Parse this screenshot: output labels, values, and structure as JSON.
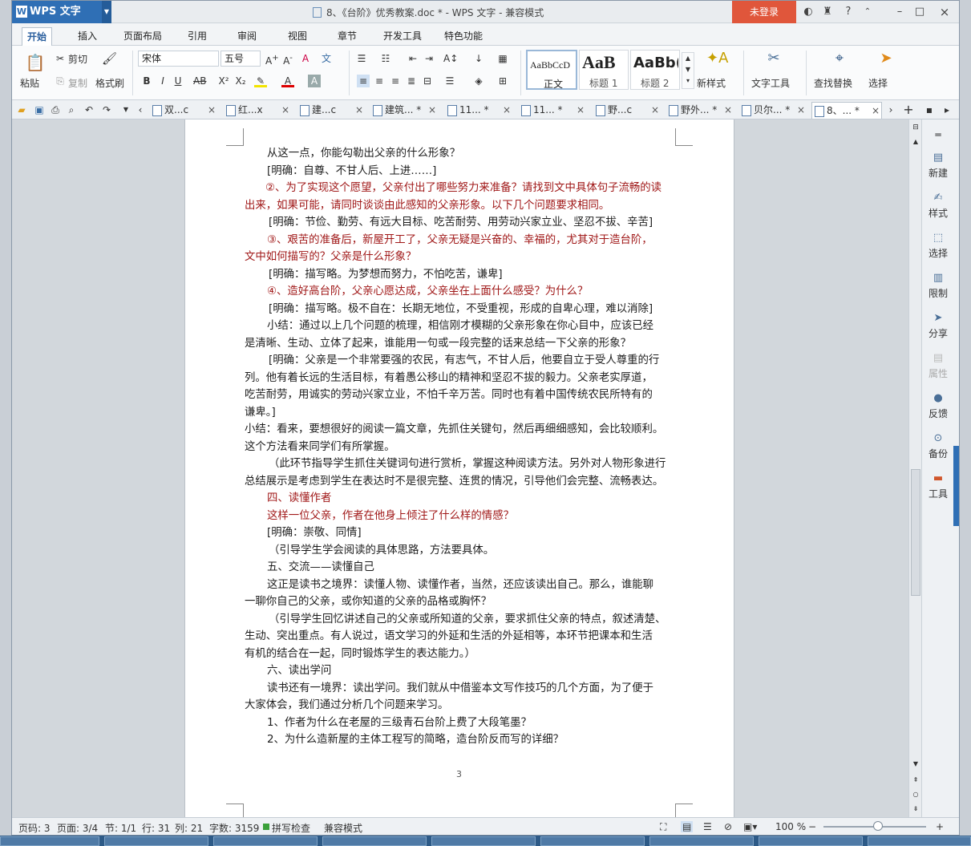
{
  "titlebar": {
    "app_name": "WPS 文字",
    "doc_title": "8、《台阶》优秀教案.doc * - WPS 文字 - 兼容模式",
    "login": "未登录"
  },
  "menu": [
    "开始",
    "插入",
    "页面布局",
    "引用",
    "审阅",
    "视图",
    "章节",
    "开发工具",
    "特色功能"
  ],
  "ribbon": {
    "paste": "粘贴",
    "cut": "剪切",
    "copy": "复制",
    "format_painter": "格式刷",
    "font_name": "宋体",
    "font_size": "五号",
    "styles": [
      {
        "preview": "AaBbCcD",
        "name": "正文"
      },
      {
        "preview": "AaB",
        "name": "标题 1"
      },
      {
        "preview": "AaBb(",
        "name": "标题 2"
      }
    ],
    "new_style": "新样式",
    "text_tools": "文字工具",
    "find_replace": "查找替换",
    "select": "选择"
  },
  "tabs": [
    {
      "label": "双...c",
      "active": false
    },
    {
      "label": "红...x",
      "active": false
    },
    {
      "label": "建...c",
      "active": false
    },
    {
      "label": "建筑... *",
      "active": false
    },
    {
      "label": "11... *",
      "active": false
    },
    {
      "label": "11... *",
      "active": false
    },
    {
      "label": "野...c",
      "active": false
    },
    {
      "label": "野外... *",
      "active": false
    },
    {
      "label": "贝尔... *",
      "active": false
    },
    {
      "label": "8、... *",
      "active": true
    }
  ],
  "document": {
    "lines": [
      {
        "text": "从这一点，你能勾勒出父亲的什么形象？",
        "red": false
      },
      {
        "text": "[明确：自尊、不甘人后、上进……]",
        "red": false
      },
      {
        "text": "②、为了实现这个愿望，父亲付出了哪些努力来准备？请找到文中具体句子流畅的读",
        "red": true
      },
      {
        "text": "出来，如果可能，请同时谈谈由此感知的父亲形象。以下几个问题要求相同。",
        "red": true
      },
      {
        "text": "[明确：节俭、勤劳、有远大目标、吃苦耐劳、用劳动兴家立业、坚忍不拔、辛苦]",
        "red": false
      },
      {
        "text": "③、艰苦的准备后，新屋开工了，父亲无疑是兴奋的、幸福的，尤其对于造台阶，",
        "red": true
      },
      {
        "text": "文中如何描写的？父亲是什么形象？",
        "red": true
      },
      {
        "text": "[明确：描写略。为梦想而努力，不怕吃苦，谦卑]",
        "red": false
      },
      {
        "text": "④、造好高台阶，父亲心愿达成，父亲坐在上面什么感受？为什么？",
        "red": true
      },
      {
        "text": "[明确：描写略。极不自在：长期无地位，不受重视，形成的自卑心理，难以消除]",
        "red": false
      },
      {
        "text": "小结：通过以上几个问题的梳理，相信刚才模糊的父亲形象在你心目中，应该已经",
        "red": false
      },
      {
        "text": "是清晰、生动、立体了起来，谁能用一句或一段完整的话来总结一下父亲的形象？",
        "red": false
      },
      {
        "text": "[明确：父亲是一个非常要强的农民，有志气，不甘人后，他要自立于受人尊重的行",
        "red": false
      },
      {
        "text": "列。他有着长远的生活目标，有着愚公移山的精神和坚忍不拔的毅力。父亲老实厚道，",
        "red": false
      },
      {
        "text": "吃苦耐劳，用诚实的劳动兴家立业，不怕千辛万苦。同时也有着中国传统农民所特有的",
        "red": false
      },
      {
        "text": "谦卑。]",
        "red": false
      },
      {
        "text": "小结：看来，要想很好的阅读一篇文章，先抓住关键句，然后再细细感知，会比较顺利。",
        "red": false
      },
      {
        "text": "这个方法看来同学们有所掌握。",
        "red": false
      },
      {
        "text": "（此环节指导学生抓住关键词句进行赏析，掌握这种阅读方法。另外对人物形象进行",
        "red": false
      },
      {
        "text": "总结展示是考虑到学生在表达时不是很完整、连贯的情况，引导他们会完整、流畅表达。",
        "red": false
      },
      {
        "text": "四、读懂作者",
        "red": true
      },
      {
        "text": "这样一位父亲，作者在他身上倾注了什么样的情感？",
        "red": true
      },
      {
        "text": "[明确：崇敬、同情]",
        "red": false
      },
      {
        "text": "（引导学生学会阅读的具体思路，方法要具体。",
        "red": false
      },
      {
        "text": "五、交流——读懂自己",
        "red": false
      },
      {
        "text": "这正是读书之境界：读懂人物、读懂作者，当然，还应该读出自己。那么，谁能聊",
        "red": false
      },
      {
        "text": "一聊你自己的父亲，或你知道的父亲的品格或胸怀？",
        "red": false
      },
      {
        "text": "（引导学生回忆讲述自己的父亲或所知道的父亲，要求抓住父亲的特点，叙述清楚、",
        "red": false
      },
      {
        "text": "生动、突出重点。有人说过，语文学习的外延和生活的外延相等，本环节把课本和生活",
        "red": false
      },
      {
        "text": "有机的结合在一起，同时锻炼学生的表达能力。）",
        "red": false
      },
      {
        "text": "六、读出学问",
        "red": false
      },
      {
        "text": "读书还有一境界：读出学问。我们就从中借鉴本文写作技巧的几个方面，为了便于",
        "red": false
      },
      {
        "text": "大家体会，我们通过分析几个问题来学习。",
        "red": false
      },
      {
        "text": "1、作者为什么在老屋的三级青石台阶上费了大段笔墨？",
        "red": false
      },
      {
        "text": "2、为什么造新屋的主体工程写的简略，造台阶反而写的详细？",
        "red": false
      }
    ],
    "page_number": "3"
  },
  "right_panel": [
    {
      "label": "新建",
      "icon": "new-icon",
      "disabled": false
    },
    {
      "label": "样式",
      "icon": "style-icon",
      "disabled": false
    },
    {
      "label": "选择",
      "icon": "select-icon",
      "disabled": false
    },
    {
      "label": "限制",
      "icon": "lock-icon",
      "disabled": false
    },
    {
      "label": "分享",
      "icon": "share-icon",
      "disabled": false
    },
    {
      "label": "属性",
      "icon": "properties-icon",
      "disabled": true
    },
    {
      "label": "反馈",
      "icon": "feedback-icon",
      "disabled": false
    },
    {
      "label": "备份",
      "icon": "backup-icon",
      "disabled": false
    },
    {
      "label": "工具",
      "icon": "toolbox-icon",
      "disabled": false
    }
  ],
  "status": {
    "page_code": "页码: 3",
    "page": "页面: 3/4",
    "section": "节: 1/1",
    "row": "行: 31",
    "col": "列: 21",
    "word_count": "字数: 3159",
    "spell_check": "拼写检查",
    "compat": "兼容模式",
    "zoom": "100 %"
  }
}
